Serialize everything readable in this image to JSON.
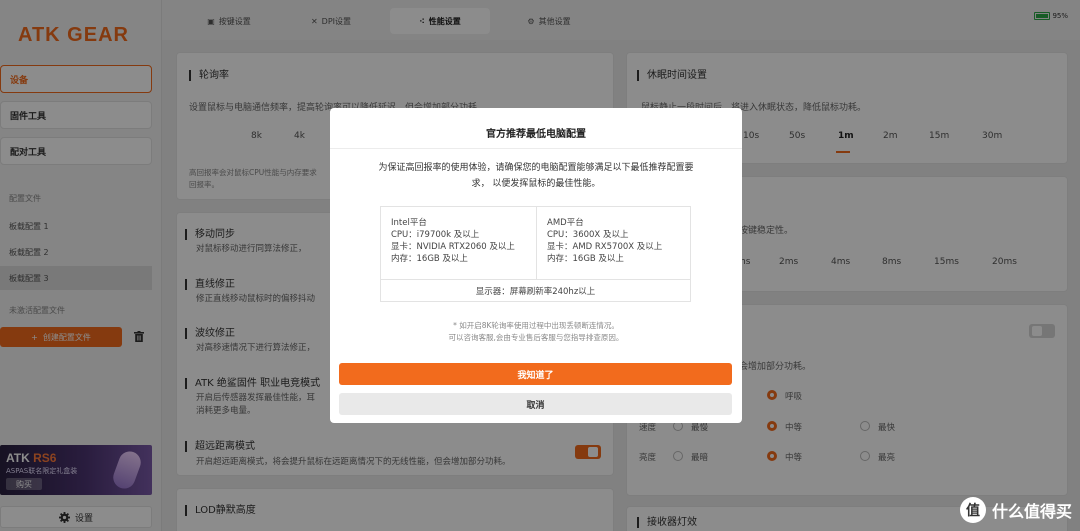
{
  "brand": {
    "logo_text": "ATK GEAR",
    "accent": "#f26b1d"
  },
  "sidebar": {
    "nav": [
      {
        "label": "设备"
      },
      {
        "label": "固件工具"
      },
      {
        "label": "配对工具"
      }
    ],
    "profiles_label": "配置文件",
    "profiles": [
      "板载配置 1",
      "板载配置 2",
      "板载配置 3"
    ],
    "inactive_label": "未激活配置文件",
    "create_button": "创建配置文件",
    "banner": {
      "title_a": "ATK ",
      "title_b": "RS6",
      "subtitle": "ASPAS联名限定礼盒装",
      "buy": "购买"
    },
    "settings_button": "设置"
  },
  "tabs": [
    {
      "label": "按键设置",
      "icon": "key-icon"
    },
    {
      "label": "DPI设置",
      "icon": "crosshair-icon"
    },
    {
      "label": "性能设置",
      "icon": "dots-icon"
    },
    {
      "label": "其他设置",
      "icon": "gear-icon"
    }
  ],
  "battery": {
    "level": 95,
    "text": "95%",
    "color": "#2aa845"
  },
  "polling": {
    "title": "轮询率",
    "desc": "设置鼠标与电脑通信频率，提高轮询率可以降低延迟，但会增加部分功耗。",
    "options": [
      "8k",
      "4k"
    ],
    "note1": "高回报率会对鼠标CPU性能与内存要求",
    "note2": "回报率。"
  },
  "sleep": {
    "title": "休眠时间设置",
    "desc": "鼠标静止一段时间后，将进入休眠状态，降低鼠标功耗。",
    "options": [
      "10s",
      "50s",
      "1m",
      "2m",
      "15m",
      "30m"
    ],
    "selected": "1m"
  },
  "debounce": {
    "desc": "按键稳定性。",
    "options": [
      "ms",
      "2ms",
      "4ms",
      "8ms",
      "15ms",
      "20ms"
    ]
  },
  "features": [
    {
      "title": "移动同步",
      "desc": "对鼠标移动进行同算法修正，"
    },
    {
      "title": "直线修正",
      "desc": "修正直线移动鼠标时的偏移抖动"
    },
    {
      "title": "波纹修正",
      "desc": "对高移速情况下进行算法修正，"
    },
    {
      "title": "ATK 绝鲨固件 职业电竞模式",
      "desc": "开启后传感器发挥最佳性能，耳",
      "desc2": "消耗更多电量。"
    },
    {
      "title": "超远距离模式",
      "desc": "开启超远距离模式，将会提升鼠标在远距离情况下的无线性能，但会增加部分功耗。"
    }
  ],
  "lod": {
    "title": "LOD静默高度"
  },
  "right_lower": {
    "desc": "会增加部分功耗。",
    "row1": [
      "呼吸"
    ],
    "row2_label": "速度",
    "row2": [
      "最慢",
      "中等",
      "最快"
    ],
    "row3_label": "亮度",
    "row3": [
      "最暗",
      "中等",
      "最亮"
    ]
  },
  "receiver": {
    "title": "接收器灯效"
  },
  "dialog": {
    "title": "官方推荐最低电脑配置",
    "message": "为保证高回报率的使用体验，请确保您的电脑配置能够满足以下最低推荐配置要求，  以便发挥鼠标的最佳性能。",
    "intel": {
      "name": "Intel平台",
      "cpu": "CPU：i79700k 及以上",
      "gpu": "显卡：NVIDIA RTX2060 及以上",
      "ram": "内存：16GB 及以上"
    },
    "amd": {
      "name": "AMD平台",
      "cpu": "CPU：3600X 及以上",
      "gpu": "显卡：AMD RX5700X 及以上",
      "ram": "内存：16GB 及以上"
    },
    "display": "显示器：屏幕刷新率240hz以上",
    "note1": "* 如开启8K轮询率使用过程中出现丢顿断连情况。",
    "note2": "可以咨询客服,会由专业售后客服与您指导排查原因。",
    "confirm": "我知道了",
    "cancel": "取消"
  },
  "watermark": {
    "text": "什么值得买",
    "badge": "值"
  }
}
